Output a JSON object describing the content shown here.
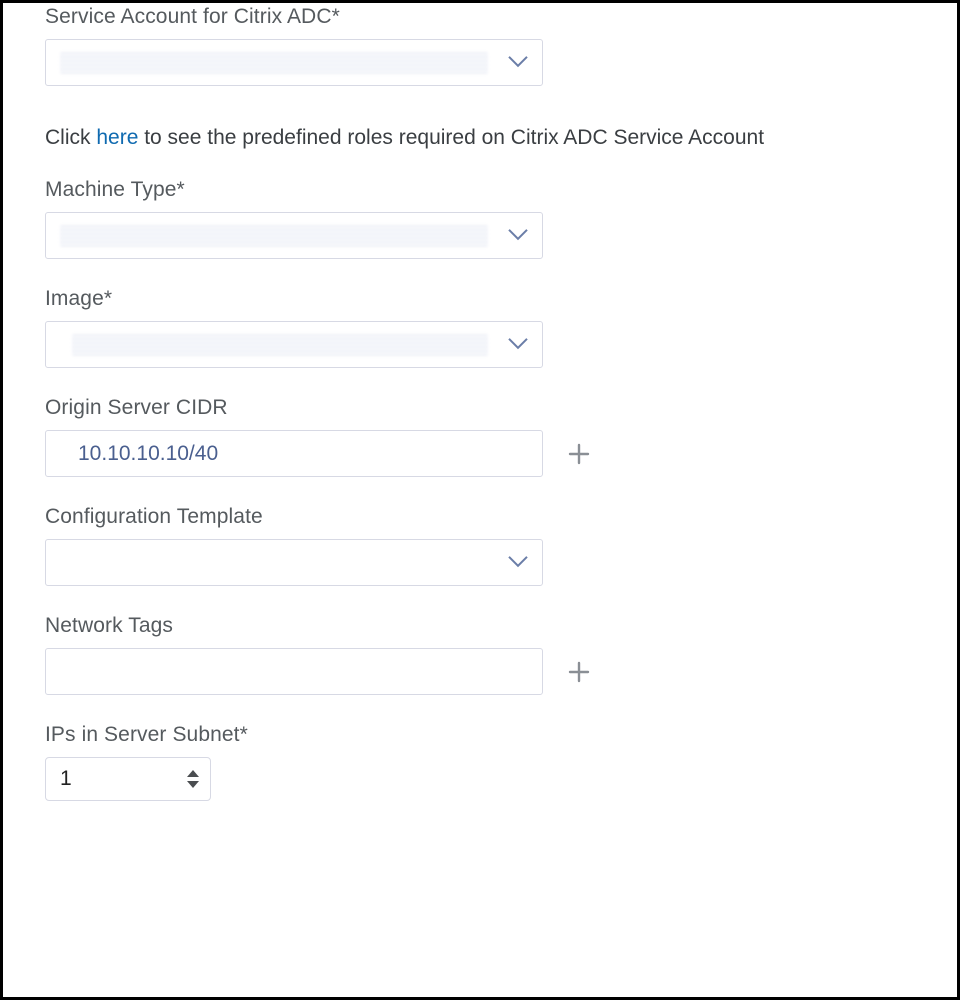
{
  "fields": {
    "serviceAccount": {
      "label": "Service Account for Citrix ADC*",
      "value_redacted": true
    },
    "helper": {
      "prefix": "Click ",
      "link": "here",
      "suffix": " to see the predefined roles required on Citrix ADC Service Account"
    },
    "machineType": {
      "label": "Machine Type*",
      "value_redacted": true
    },
    "image": {
      "label": "Image*",
      "value_redacted": true
    },
    "originCidr": {
      "label": "Origin Server CIDR",
      "value": "10.10.10.10/40"
    },
    "configTemplate": {
      "label": "Configuration Template",
      "value": ""
    },
    "networkTags": {
      "label": "Network Tags",
      "value": ""
    },
    "ipsInSubnet": {
      "label": "IPs in Server Subnet*",
      "value": "1"
    }
  }
}
